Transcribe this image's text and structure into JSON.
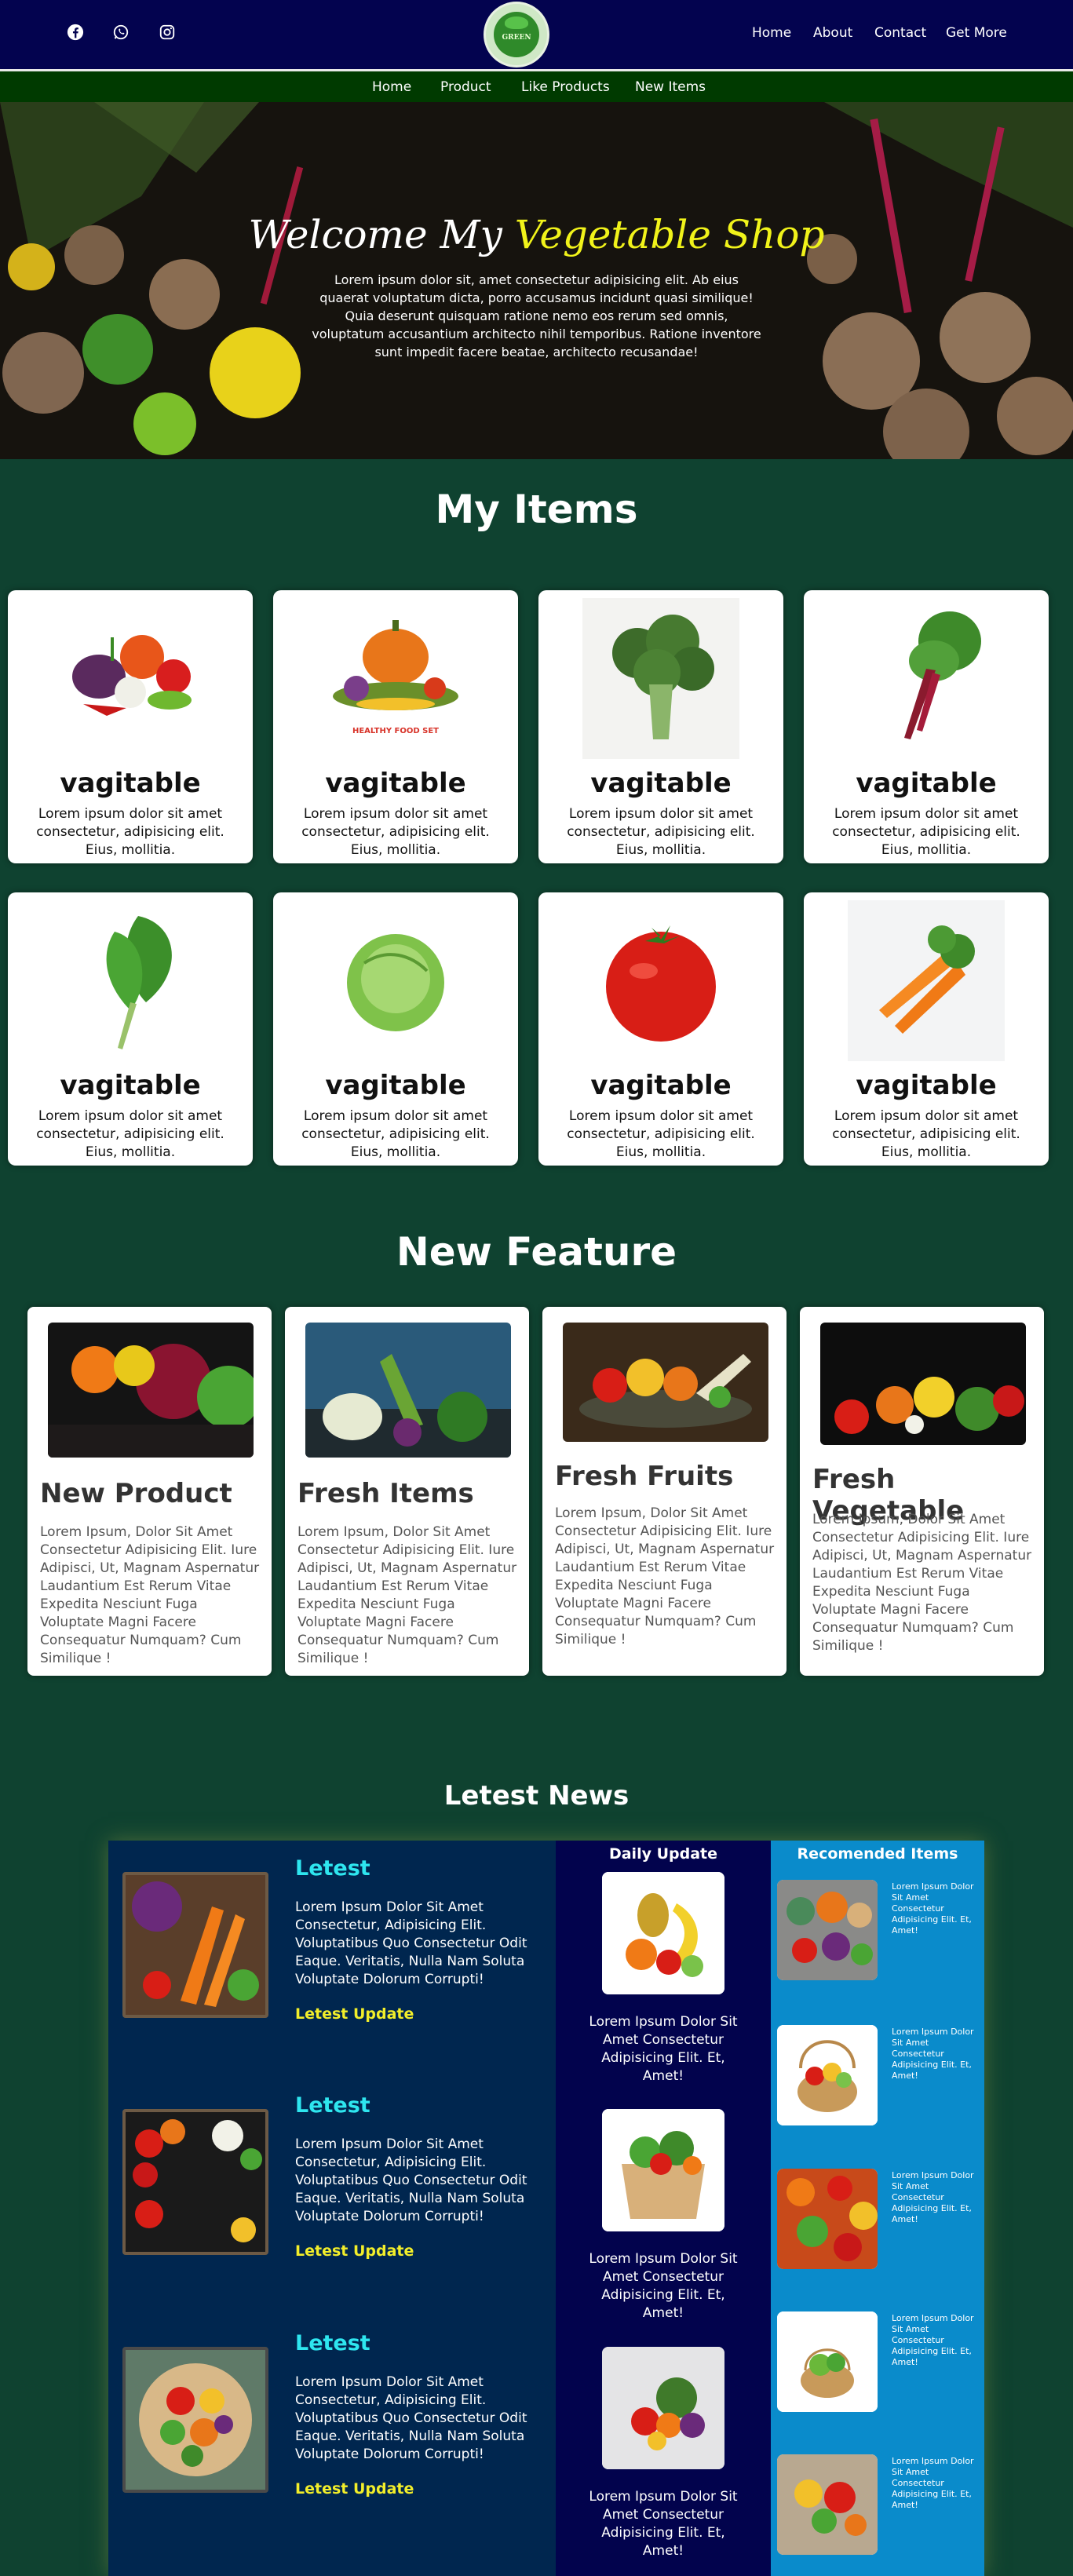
{
  "header": {
    "social": [
      "facebook-icon",
      "whatsapp-icon",
      "instagram-icon"
    ],
    "logo_text": "GREEN",
    "nav": [
      "Home",
      "About",
      "Contact",
      "Get More"
    ]
  },
  "subnav": [
    "Home",
    "Product",
    "Like Products",
    "New Items"
  ],
  "hero": {
    "title_part1": "Welcome My",
    "title_part2": "Vegetable Shop",
    "text": "Lorem ipsum dolor sit, amet consectetur adipisicing elit. Ab eius quaerat voluptatum dicta, porro accusamus incidunt quasi similique! Quia deserunt quisquam ratione nemo eos rerum sed omnis, voluptatum accusantium architecto nihil temporibus. Ratione inventore sunt impedit facere beatae, architecto recusandae!"
  },
  "my_items": {
    "title": "My Items",
    "items": [
      {
        "name": "vagitable",
        "desc": "Lorem ipsum dolor sit amet consectetur, adipisicing elit. Eius, mollitia.",
        "image": "mixed-vegetables"
      },
      {
        "name": "vagitable",
        "desc": "Lorem ipsum dolor sit amet consectetur, adipisicing elit. Eius, mollitia.",
        "image": "pumpkin-basket",
        "caption": "HEALTHY FOOD SET"
      },
      {
        "name": "vagitable",
        "desc": "Lorem ipsum dolor sit amet consectetur, adipisicing elit. Eius, mollitia.",
        "image": "broccoli"
      },
      {
        "name": "vagitable",
        "desc": "Lorem ipsum dolor sit amet consectetur, adipisicing elit. Eius, mollitia.",
        "image": "beet-greens"
      },
      {
        "name": "vagitable",
        "desc": "Lorem ipsum dolor sit amet consectetur, adipisicing elit. Eius, mollitia.",
        "image": "kale"
      },
      {
        "name": "vagitable",
        "desc": "Lorem ipsum dolor sit amet consectetur, adipisicing elit. Eius, mollitia.",
        "image": "cabbage"
      },
      {
        "name": "vagitable",
        "desc": "Lorem ipsum dolor sit amet consectetur, adipisicing elit. Eius, mollitia.",
        "image": "tomato"
      },
      {
        "name": "vagitable",
        "desc": "Lorem ipsum dolor sit amet consectetur, adipisicing elit. Eius, mollitia.",
        "image": "carrots"
      }
    ]
  },
  "features": {
    "title": "New Feature",
    "items": [
      {
        "title": "New Product",
        "desc": "Lorem Ipsum, Dolor Sit Amet Consectetur Adipisicing Elit. Iure Adipisci, Ut, Magnam Aspernatur Laudantium Est Rerum Vitae Expedita Nesciunt Fuga Voluptate Magni Facere Consequatur Numquam? Cum Similique !"
      },
      {
        "title": "Fresh Items",
        "desc": "Lorem Ipsum, Dolor Sit Amet Consectetur Adipisicing Elit. Iure Adipisci, Ut, Magnam Aspernatur Laudantium Est Rerum Vitae Expedita Nesciunt Fuga Voluptate Magni Facere Consequatur Numquam? Cum Similique !"
      },
      {
        "title": "Fresh Fruits",
        "desc": "Lorem Ipsum, Dolor Sit Amet Consectetur Adipisicing Elit. Iure Adipisci, Ut, Magnam Aspernatur Laudantium Est Rerum Vitae Expedita Nesciunt Fuga Voluptate Magni Facere Consequatur Numquam? Cum Similique !"
      },
      {
        "title": "Fresh Vegetable",
        "desc": "Lorem Ipsum, Dolor Sit Amet Consectetur Adipisicing Elit. Iure Adipisci, Ut, Magnam Aspernatur Laudantium Est Rerum Vitae Expedita Nesciunt Fuga Voluptate Magni Facere Consequatur Numquam? Cum Similique !"
      }
    ]
  },
  "news": {
    "title": "Letest News",
    "articles": [
      {
        "title": "Letest",
        "text": "Lorem Ipsum Dolor Sit Amet Consectetur, Adipisicing Elit. Voluptatibus Quo Consectetur Odit Eaque. Veritatis, Nulla Nam Soluta Voluptate Dolorum Corrupti!",
        "link": "Letest Update"
      },
      {
        "title": "Letest",
        "text": "Lorem Ipsum Dolor Sit Amet Consectetur, Adipisicing Elit. Voluptatibus Quo Consectetur Odit Eaque. Veritatis, Nulla Nam Soluta Voluptate Dolorum Corrupti!",
        "link": "Letest Update"
      },
      {
        "title": "Letest",
        "text": "Lorem Ipsum Dolor Sit Amet Consectetur, Adipisicing Elit. Voluptatibus Quo Consectetur Odit Eaque. Veritatis, Nulla Nam Soluta Voluptate Dolorum Corrupti!",
        "link": "Letest Update"
      }
    ],
    "daily": {
      "title": "Daily Update",
      "items": [
        "Lorem Ipsum Dolor Sit Amet Consectetur Adipisicing Elit. Et, Amet!",
        "Lorem Ipsum Dolor Sit Amet Consectetur Adipisicing Elit. Et, Amet!",
        "Lorem Ipsum Dolor Sit Amet Consectetur Adipisicing Elit. Et, Amet!"
      ]
    },
    "recommended": {
      "title": "Recomended Items",
      "items": [
        "Lorem Ipsum Dolor Sit Amet Consectetur Adipisicing Elit. Et, Amet!",
        "Lorem Ipsum Dolor Sit Amet Consectetur Adipisicing Elit. Et, Amet!",
        "Lorem Ipsum Dolor Sit Amet Consectetur Adipisicing Elit. Et, Amet!",
        "Lorem Ipsum Dolor Sit Amet Consectetur Adipisicing Elit. Et, Amet!",
        "Lorem Ipsum Dolor Sit Amet Consectetur Adipisicing Elit. Et, Amet!"
      ]
    }
  }
}
